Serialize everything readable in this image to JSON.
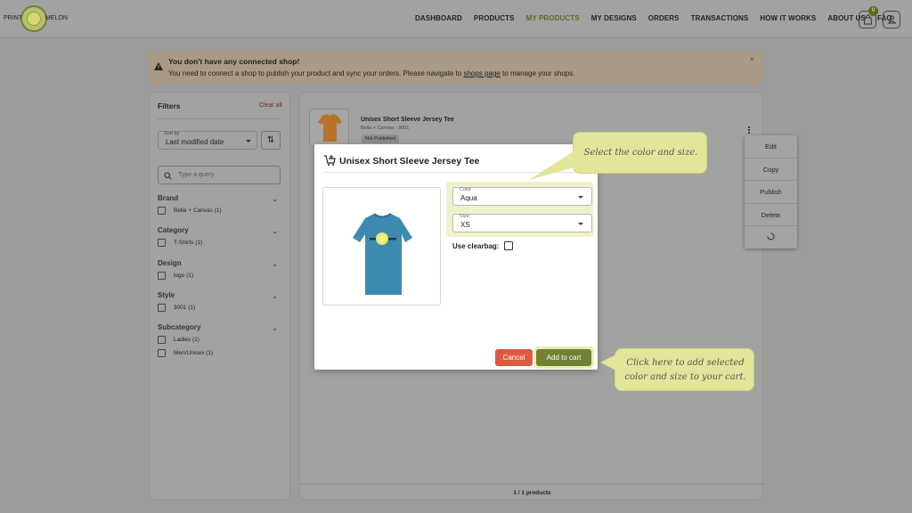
{
  "brand": {
    "left": "PRINT",
    "right": "MELON"
  },
  "nav": {
    "items": [
      "DASHBOARD",
      "PRODUCTS",
      "MY PRODUCTS",
      "MY DESIGNS",
      "ORDERS",
      "TRANSACTIONS",
      "HOW IT WORKS",
      "ABOUT US",
      "FAQ"
    ],
    "active_index": 2
  },
  "cart": {
    "count": "0",
    "icon": "shopping-bag-icon"
  },
  "user": {
    "icon": "user-icon"
  },
  "alert": {
    "title": "You don't have any connected shop!",
    "message_before": "You need to connect a shop to publish your product and sync your orders. Please navigate to ",
    "link": "shops page",
    "message_after": " to manage your shops.",
    "close": "×"
  },
  "filters": {
    "title": "Filters",
    "clear_all": "Clear all",
    "sort_label": "Sort by",
    "sort_value": "Last modified date",
    "search_placeholder": "Type a query",
    "groups": [
      {
        "name": "Brand",
        "options": [
          "Bella + Canvas (1)"
        ]
      },
      {
        "name": "Category",
        "options": [
          "T-Shirts (1)"
        ]
      },
      {
        "name": "Design",
        "options": [
          "logo (1)"
        ]
      },
      {
        "name": "Style",
        "options": [
          "3001 (1)"
        ]
      },
      {
        "name": "Subcategory",
        "options": [
          "Ladies (1)",
          "Men/Unisex (1)"
        ]
      }
    ]
  },
  "product": {
    "title": "Unisex Short Sleeve Jersey Tee",
    "subtitle": "Bella + Canvas - 3001",
    "status": "Not Published"
  },
  "context_menu": {
    "items": [
      "Edit",
      "Copy",
      "Publish",
      "Delete"
    ],
    "loading_icon": "spinner-icon"
  },
  "footer": {
    "count": "1 / 1 products"
  },
  "modal": {
    "title": "Unisex Short Sleeve Jersey Tee",
    "color_label": "Color",
    "color_value": "Aqua",
    "size_label": "Size",
    "size_value": "XS",
    "clearbag_label": "Use clearbag:",
    "cancel": "Cancel",
    "add_to_cart": "Add to cart",
    "shirt_color": "#3d8ab0"
  },
  "callouts": {
    "select": "Select the color and size.",
    "add_line1": "Click here to add selected",
    "add_line2": "color and size to your cart."
  },
  "colors": {
    "accent": "#6f8232",
    "danger": "#dc5a43",
    "callout": "#e3e59a"
  }
}
